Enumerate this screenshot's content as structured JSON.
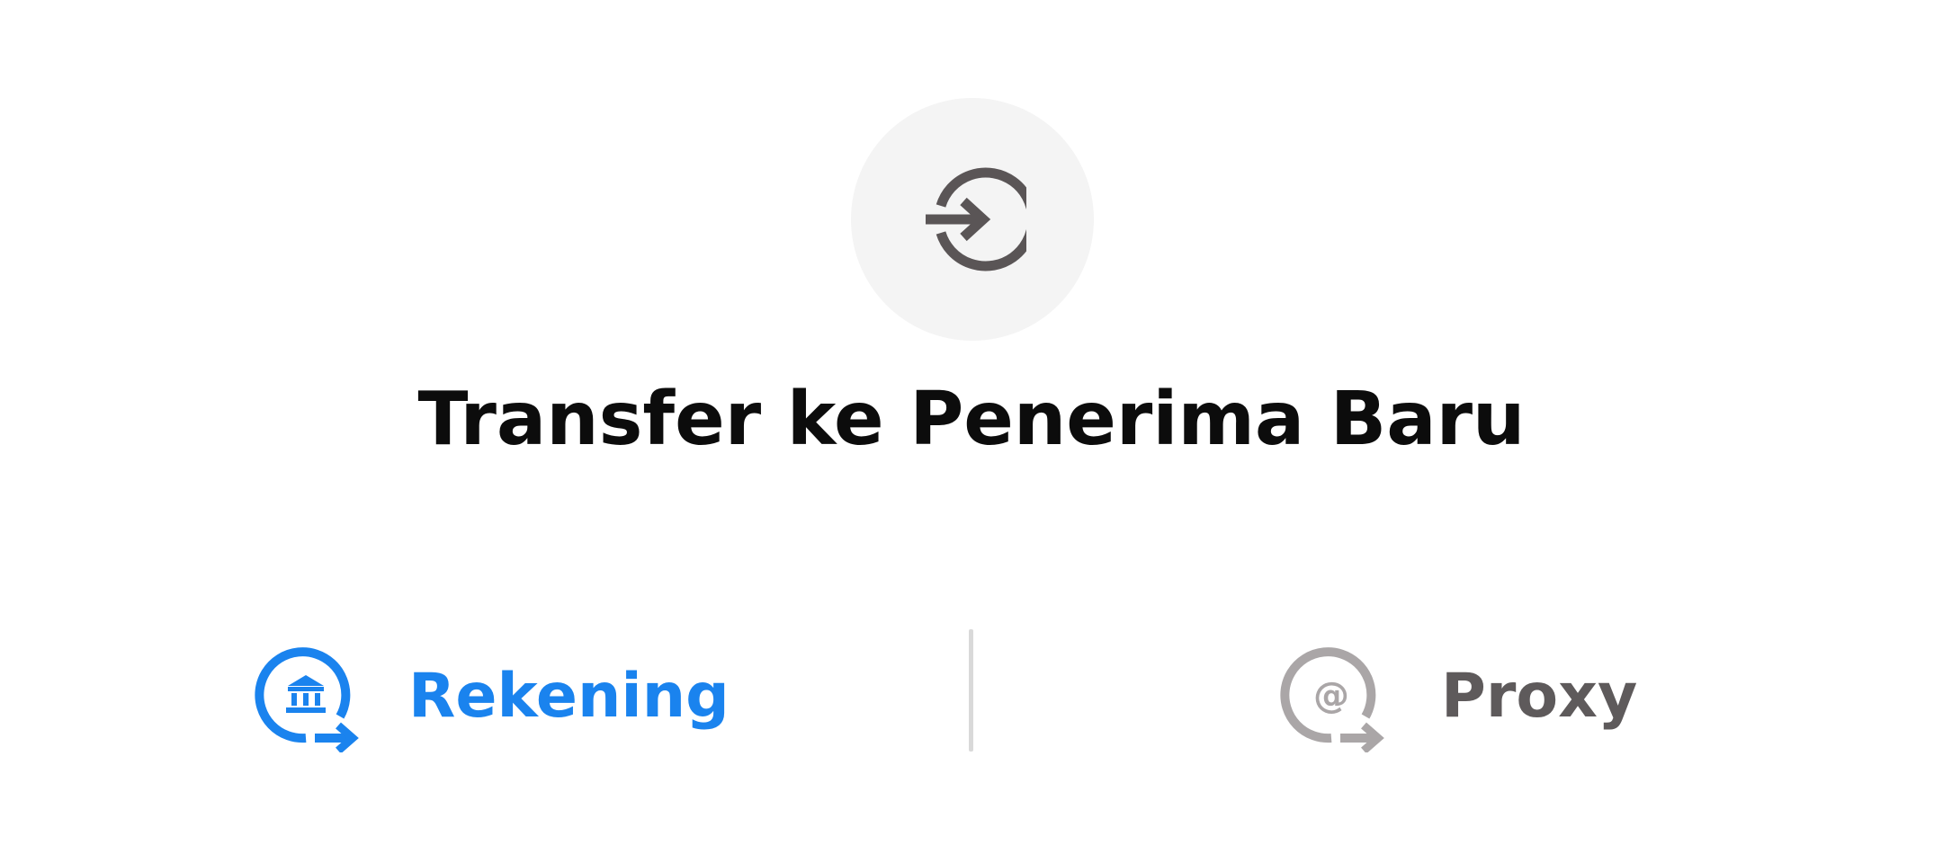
{
  "header": {
    "icon": "login-arrow-icon",
    "title": "Transfer ke Penerima Baru"
  },
  "tabs": [
    {
      "id": "rekening",
      "label": "Rekening",
      "icon": "bank-transfer-icon",
      "active": true,
      "color": "#1a83ee"
    },
    {
      "id": "proxy",
      "label": "Proxy",
      "icon": "at-transfer-icon",
      "active": false,
      "color": "#5e5a5b"
    }
  ],
  "colors": {
    "accent": "#1a83ee",
    "inactive_text": "#5e5a5b",
    "inactive_icon": "#aaa6a7",
    "icon_bg": "#f4f4f4",
    "icon_fg": "#5a5556"
  }
}
